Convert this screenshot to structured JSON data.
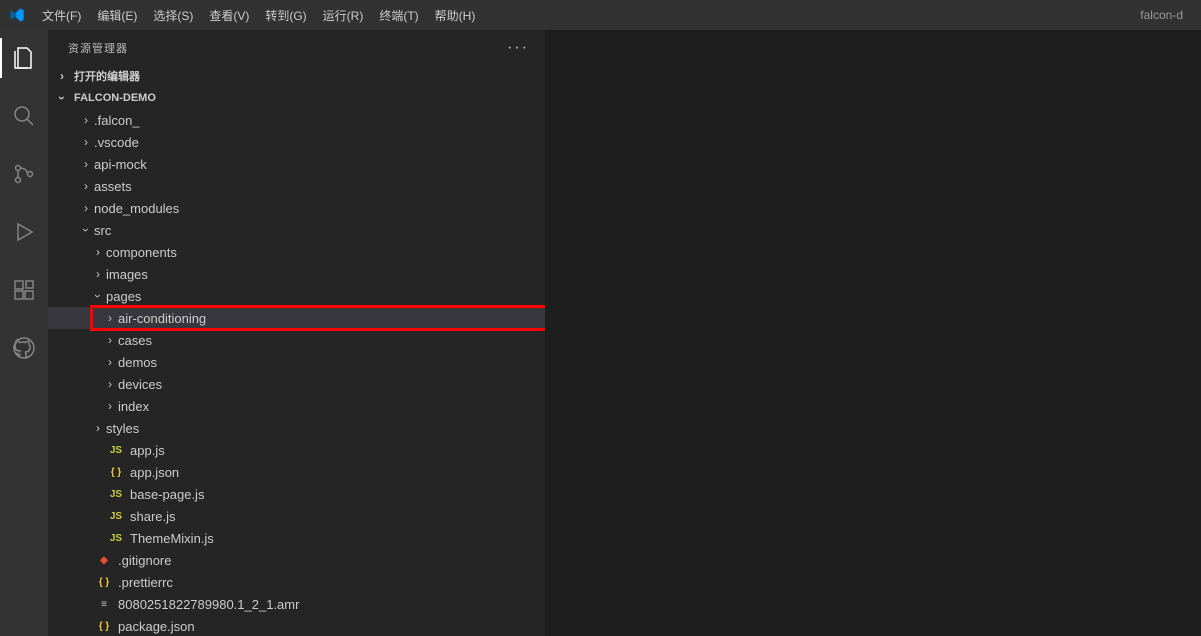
{
  "menubar": {
    "items": [
      "文件(F)",
      "编辑(E)",
      "选择(S)",
      "查看(V)",
      "转到(G)",
      "运行(R)",
      "终端(T)",
      "帮助(H)"
    ],
    "title": "falcon-d"
  },
  "sidebar": {
    "title": "资源管理器",
    "sections": {
      "openEditors": "打开的编辑器",
      "projectName": "FALCON-DEMO"
    }
  },
  "tree": {
    "items": [
      {
        "indent": 1,
        "type": "folder",
        "state": "collapsed",
        "label": ".falcon_",
        "icon": ""
      },
      {
        "indent": 1,
        "type": "folder",
        "state": "collapsed",
        "label": ".vscode",
        "icon": ""
      },
      {
        "indent": 1,
        "type": "folder",
        "state": "collapsed",
        "label": "api-mock",
        "icon": ""
      },
      {
        "indent": 1,
        "type": "folder",
        "state": "collapsed",
        "label": "assets",
        "icon": ""
      },
      {
        "indent": 1,
        "type": "folder",
        "state": "collapsed",
        "label": "node_modules",
        "icon": ""
      },
      {
        "indent": 1,
        "type": "folder",
        "state": "expanded",
        "label": "src",
        "icon": ""
      },
      {
        "indent": 2,
        "type": "folder",
        "state": "collapsed",
        "label": "components",
        "icon": ""
      },
      {
        "indent": 2,
        "type": "folder",
        "state": "collapsed",
        "label": "images",
        "icon": ""
      },
      {
        "indent": 2,
        "type": "folder",
        "state": "expanded",
        "label": "pages",
        "icon": ""
      },
      {
        "indent": 3,
        "type": "folder",
        "state": "collapsed",
        "label": "air-conditioning",
        "icon": "",
        "highlighted": true
      },
      {
        "indent": 3,
        "type": "folder",
        "state": "collapsed",
        "label": "cases",
        "icon": ""
      },
      {
        "indent": 3,
        "type": "folder",
        "state": "collapsed",
        "label": "demos",
        "icon": ""
      },
      {
        "indent": 3,
        "type": "folder",
        "state": "collapsed",
        "label": "devices",
        "icon": ""
      },
      {
        "indent": 3,
        "type": "folder",
        "state": "collapsed",
        "label": "index",
        "icon": ""
      },
      {
        "indent": 2,
        "type": "folder",
        "state": "collapsed",
        "label": "styles",
        "icon": ""
      },
      {
        "indent": 2,
        "type": "file",
        "label": "app.js",
        "icon": "JS",
        "iconClass": "icon-js"
      },
      {
        "indent": 2,
        "type": "file",
        "label": "app.json",
        "icon": "{ }",
        "iconClass": "icon-json"
      },
      {
        "indent": 2,
        "type": "file",
        "label": "base-page.js",
        "icon": "JS",
        "iconClass": "icon-js"
      },
      {
        "indent": 2,
        "type": "file",
        "label": "share.js",
        "icon": "JS",
        "iconClass": "icon-js"
      },
      {
        "indent": 2,
        "type": "file",
        "label": "ThemeMixin.js",
        "icon": "JS",
        "iconClass": "icon-js"
      },
      {
        "indent": 1,
        "type": "file",
        "label": ".gitignore",
        "icon": "◆",
        "iconClass": "icon-git"
      },
      {
        "indent": 1,
        "type": "file",
        "label": ".prettierrc",
        "icon": "{ }",
        "iconClass": "icon-json"
      },
      {
        "indent": 1,
        "type": "file",
        "label": "8080251822789980.1_2_1.amr",
        "icon": "≡",
        "iconClass": "icon-file"
      },
      {
        "indent": 1,
        "type": "file",
        "label": "package.json",
        "icon": "{ }",
        "iconClass": "icon-json"
      }
    ]
  }
}
